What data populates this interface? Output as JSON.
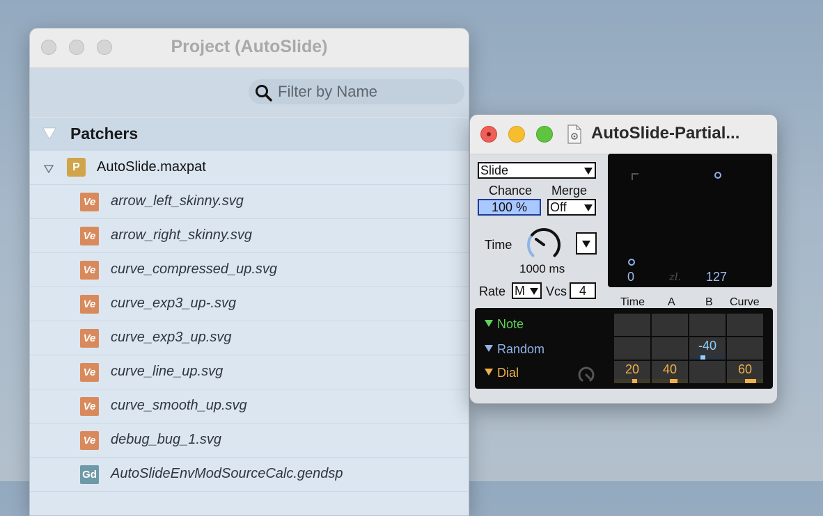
{
  "project": {
    "title": "Project (AutoSlide)",
    "search_placeholder": "Filter by Name",
    "section_label": "Patchers",
    "root": {
      "badge": "P",
      "name": "AutoSlide.maxpat"
    },
    "files": [
      {
        "badge": "Ve",
        "name": "arrow_left_skinny.svg"
      },
      {
        "badge": "Ve",
        "name": "arrow_right_skinny.svg"
      },
      {
        "badge": "Ve",
        "name": "curve_compressed_up.svg"
      },
      {
        "badge": "Ve",
        "name": "curve_exp3_up-.svg"
      },
      {
        "badge": "Ve",
        "name": "curve_exp3_up.svg"
      },
      {
        "badge": "Ve",
        "name": "curve_line_up.svg"
      },
      {
        "badge": "Ve",
        "name": "curve_smooth_up.svg"
      },
      {
        "badge": "Ve",
        "name": "debug_bug_1.svg"
      },
      {
        "badge": "Gd",
        "name": "AutoSlideEnvModSourceCalc.gendsp"
      }
    ]
  },
  "device": {
    "title": "AutoSlide-Partial...",
    "mode_value": "Slide",
    "chance_label": "Chance",
    "chance_value": "100 %",
    "merge_label": "Merge",
    "merge_value": "Off",
    "time_label": "Time",
    "time_value": "1000 ms",
    "time_knob_fraction": 0.3,
    "rate_label": "Rate",
    "rate_value": "M",
    "vcs_label": "Vcs",
    "vcs_value": "4",
    "xy": {
      "min_label": "0",
      "max_label": "127",
      "logo": "zl."
    },
    "matrix_headers": [
      "Time",
      "A",
      "B",
      "Curve"
    ],
    "sources": [
      {
        "name": "Note",
        "color": "#5fd35a"
      },
      {
        "name": "Random",
        "color": "#8fb3e8"
      },
      {
        "name": "Dial",
        "color": "#f0b04a"
      }
    ],
    "random_b_value": "-40",
    "dial_values": {
      "time": "20",
      "a": "40",
      "curve": "60"
    }
  },
  "colors": {
    "accent_blue": "#a9c8ff",
    "mod_orange": "#f0b04a",
    "mod_blue": "#8fd0ff"
  }
}
